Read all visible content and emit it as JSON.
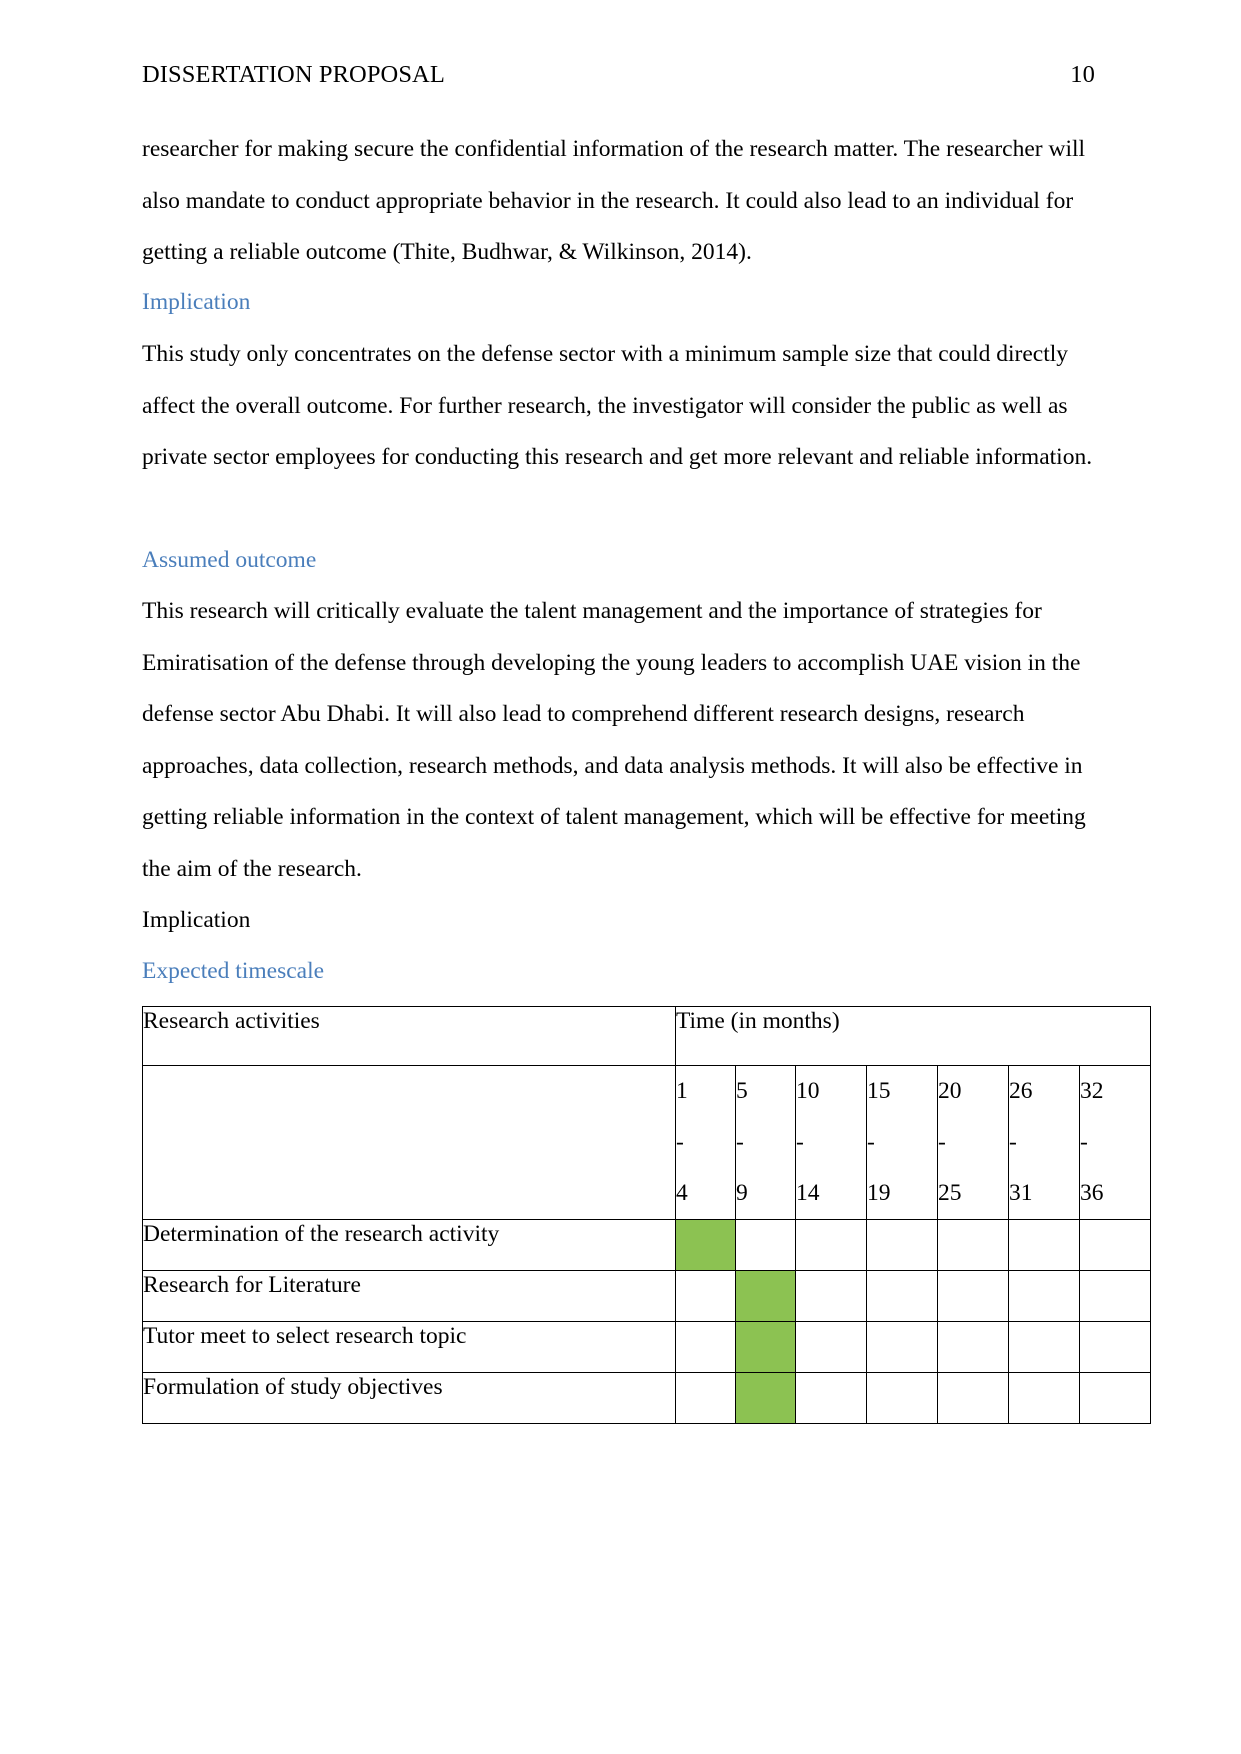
{
  "header": {
    "document_title": "DISSERTATION PROPOSAL",
    "page_number": "10"
  },
  "body": {
    "paragraph_1": "researcher for making secure the confidential information of the research matter. The researcher will also mandate to conduct appropriate behavior in the research. It could also lead to an individual for getting a reliable outcome (Thite, Budhwar, & Wilkinson, 2014).",
    "heading_implication": "Implication",
    "paragraph_2": "This study only concentrates on the defense sector with a minimum sample size that could directly affect the overall outcome. For further research, the investigator will consider the public as well as private sector employees for conducting this research and get more relevant and reliable information.",
    "heading_assumed_outcome": "Assumed outcome",
    "paragraph_3": "This research will critically evaluate the talent management and the importance of strategies for Emiratisation of the defense through developing the young leaders to accomplish UAE vision in the defense sector Abu Dhabi. It will also lead to comprehend different research designs, research approaches, data collection, research methods, and data analysis methods. It will also be effective in getting reliable information in the context of talent management, which will be effective for meeting the aim of the research.",
    "heading_implication_2": "Implication",
    "heading_expected_timescale": "Expected timescale"
  },
  "colors": {
    "heading_blue": "#4a7ebb",
    "gantt_fill_green": "#8cc252",
    "table_border": "#000000",
    "text": "#000000"
  },
  "gantt": {
    "col_header_activities": "Research activities",
    "col_header_time": "Time (in months)",
    "month_ranges": [
      {
        "start": "1",
        "dash": "-",
        "end": "4"
      },
      {
        "start": "5",
        "dash": "-",
        "end": "9"
      },
      {
        "start": "10",
        "dash": "-",
        "end": "14"
      },
      {
        "start": "15",
        "dash": "-",
        "end": "19"
      },
      {
        "start": "20",
        "dash": "-",
        "end": "25"
      },
      {
        "start": "26",
        "dash": "-",
        "end": "31"
      },
      {
        "start": "32",
        "dash": "-",
        "end": "36"
      }
    ],
    "rows": [
      {
        "activity": "Determination of the research activity",
        "bars": [
          1,
          0,
          0,
          0,
          0,
          0,
          0
        ]
      },
      {
        "activity": "Research for Literature",
        "bars": [
          0,
          1,
          0,
          0,
          0,
          0,
          0
        ]
      },
      {
        "activity": "Tutor meet to select research topic",
        "bars": [
          0,
          1,
          0,
          0,
          0,
          0,
          0
        ]
      },
      {
        "activity": "Formulation of  study objectives",
        "bars": [
          0,
          1,
          0,
          0,
          0,
          0,
          0
        ]
      }
    ]
  }
}
